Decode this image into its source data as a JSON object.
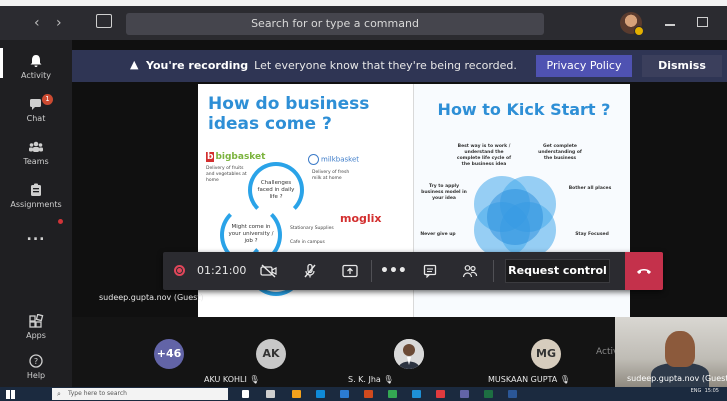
{
  "titlebar": {
    "back": "‹",
    "forward": "›",
    "search_placeholder": "Search for or type a command"
  },
  "rail": {
    "items": [
      {
        "label": "Activity",
        "icon": "bell-icon",
        "badge": ""
      },
      {
        "label": "Chat",
        "icon": "chat-icon",
        "badge": "1"
      },
      {
        "label": "Teams",
        "icon": "teams-icon",
        "badge": ""
      },
      {
        "label": "Assignments",
        "icon": "assignments-icon",
        "badge": ""
      },
      {
        "label": "...",
        "icon": "more-icon",
        "badge": ""
      },
      {
        "label": "Apps",
        "icon": "apps-icon",
        "badge": ""
      },
      {
        "label": "Help",
        "icon": "help-icon",
        "badge": ""
      }
    ]
  },
  "banner": {
    "title": "You're recording",
    "message": "Let everyone know that they're being recorded.",
    "privacy_label": "Privacy Policy",
    "dismiss_label": "Dismiss"
  },
  "slide": {
    "left_title": "How do business ideas come ?",
    "right_title": "How to Kick Start ?",
    "logo_bigbasket": "bigbasket",
    "logo_milkbasket": "milkbasket",
    "logo_moglix": "moglix",
    "bigbasket_note": "Delivery of fruits and vegetables at home",
    "milkbasket_note": "Delivery of fresh milk at home",
    "bubble1": "Challenges faced in daily life ?",
    "bubble2": "Might come in your university / job ?",
    "moglix_note1": "Stationary Supplies",
    "moglix_note2": "Cafe in campus",
    "venn_tl": "Best way is to work / understand the complete life cycle of the business idea",
    "venn_tr": "Get complete understanding of the business",
    "venn_ml": "Try to apply business model in your idea",
    "venn_mr": "Bother all places",
    "venn_bl": "Never give up",
    "venn_br": "Stay Focused"
  },
  "presenter_name": "sudeep.gupta.nov (Guest)",
  "controls": {
    "timer": "01:21:00",
    "request_control": "Request control"
  },
  "participants": {
    "more_count": "+46",
    "people": [
      {
        "initials": "AK",
        "name": "AKU KOHLI"
      },
      {
        "initials": "",
        "name": "S. K. Jha"
      },
      {
        "initials": "MG",
        "name": "MUSKAAN GUPTA"
      }
    ],
    "self_name": "sudeep.gupta.nov (Guest)",
    "activate_text": "Activ"
  },
  "taskbar": {
    "search_placeholder": "Type here to search",
    "time": "15:05",
    "lang": "ENG"
  },
  "colors": {
    "accent": "#4f52b2",
    "banner": "#2f3554",
    "hangup": "#c4314b",
    "record": "#e0465a"
  }
}
